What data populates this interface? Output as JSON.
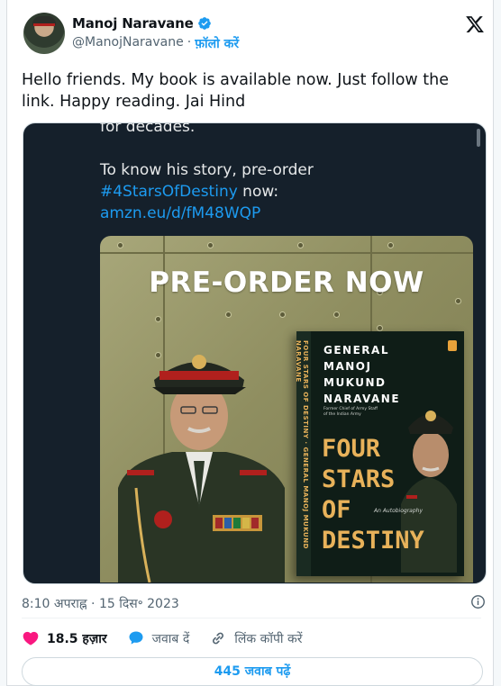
{
  "author": {
    "name": "Manoj Naravane",
    "handle": "@ManojNaravane",
    "separator": "·",
    "follow_label": "फ़ॉलो करें"
  },
  "tweet": {
    "text": "Hello friends. My book is available now. Just follow the link. Happy reading. Jai Hind"
  },
  "media": {
    "cut_text": "for decades.",
    "story_line1": "To know his story, pre-order",
    "hashtag": "#4StarsOfDestiny",
    "hashtag_suffix": " now:",
    "url": "amzn.eu/d/fM48WQP",
    "promo_title": "PRE-ORDER NOW",
    "book": {
      "author_line1": "GENERAL",
      "author_line2": "MANOJ",
      "author_line3": "MUKUND",
      "author_line4": "NARAVANE",
      "subtitle_line1": "Former Chief of Army Staff",
      "subtitle_line2": "of the Indian Army",
      "title_line1": "FOUR",
      "title_line2": "STARS",
      "title_line3": "OF",
      "title_line4": "DESTINY",
      "autobiography": "An Autobiography",
      "spine_title": "FOUR STARS OF DESTINY",
      "spine_author": "GENERAL MANOJ MUKUND NARAVANE"
    }
  },
  "meta": {
    "timestamp": "8:10 अपराह्न · 15 दिस॰ 2023"
  },
  "actions": {
    "likes": "18.5 हज़ार",
    "reply": "जवाब दें",
    "copy_link": "लिंक कॉपी करें"
  },
  "read_replies": "445 जवाब पढ़ें",
  "colors": {
    "accent": "#1d9bf0",
    "like": "#f91880",
    "muted": "#536471",
    "media_bg": "#15202b"
  },
  "icons": {
    "verified": "verified-badge-icon",
    "x_logo": "x-logo-icon",
    "info": "info-icon",
    "like": "heart-icon",
    "reply": "speech-bubble-icon",
    "link": "link-icon"
  }
}
